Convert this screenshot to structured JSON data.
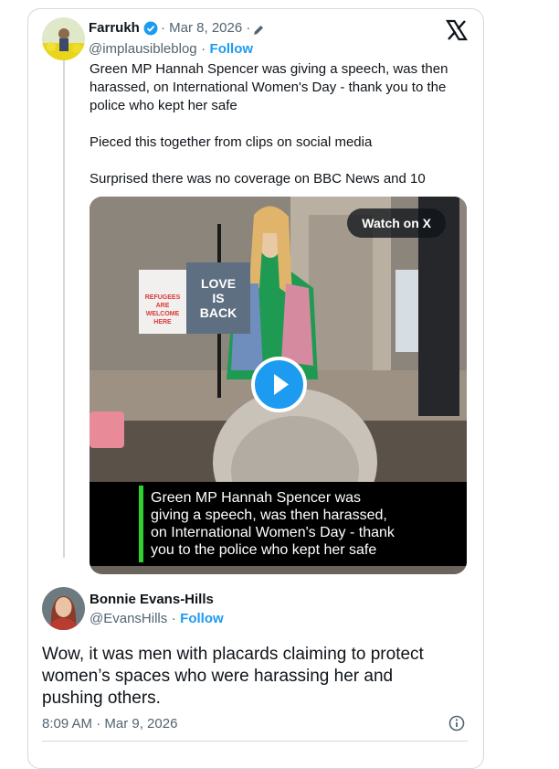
{
  "original_post": {
    "author_name": "Farrukh",
    "date": "· Mar 8, 2026 ·",
    "handle": "@implausibleblog",
    "separator": "·",
    "follow_label": "Follow",
    "text_line_1": "Green MP Hannah Spencer was giving a speech, was then",
    "text_line_2": "harassed, on International Women's Day - thank you to the",
    "text_line_3": "police who kept her safe",
    "text_line_4": "Pieced this together from clips on social media",
    "text_line_5": "Surprised there was no coverage on BBC News and 10",
    "media": {
      "watch_label": "Watch on X",
      "placard_text_1": "LOVE",
      "placard_text_2": "IS",
      "placard_text_3": "BACK",
      "sign_text_1": "REFUGEES",
      "sign_text_2": "ARE",
      "sign_text_3": "WELCOME",
      "sign_text_4": "HERE",
      "caption_line_1": "Green MP Hannah Spencer was",
      "caption_line_2": "giving a speech, was then harassed,",
      "caption_line_3": "on International Women's Day - thank",
      "caption_line_4": "you to the police who kept her safe"
    }
  },
  "reply": {
    "author_name": "Bonnie Evans-Hills",
    "handle": "@EvansHills",
    "separator": "·",
    "follow_label": "Follow",
    "text_line_1": "Wow, it was men with placards claiming to protect",
    "text_line_2": "women’s spaces who were harassing her and",
    "text_line_3": "pushing others.",
    "timestamp": "8:09 AM · Mar 9, 2026"
  },
  "colors": {
    "accent": "#1d9bf0",
    "verified": "#1d9bf0",
    "caption_bar": "#2ed12e"
  },
  "icons": [
    "avatar",
    "verified-badge-icon",
    "edit-pencil-icon",
    "x-logo-icon",
    "play-icon",
    "info-icon"
  ]
}
